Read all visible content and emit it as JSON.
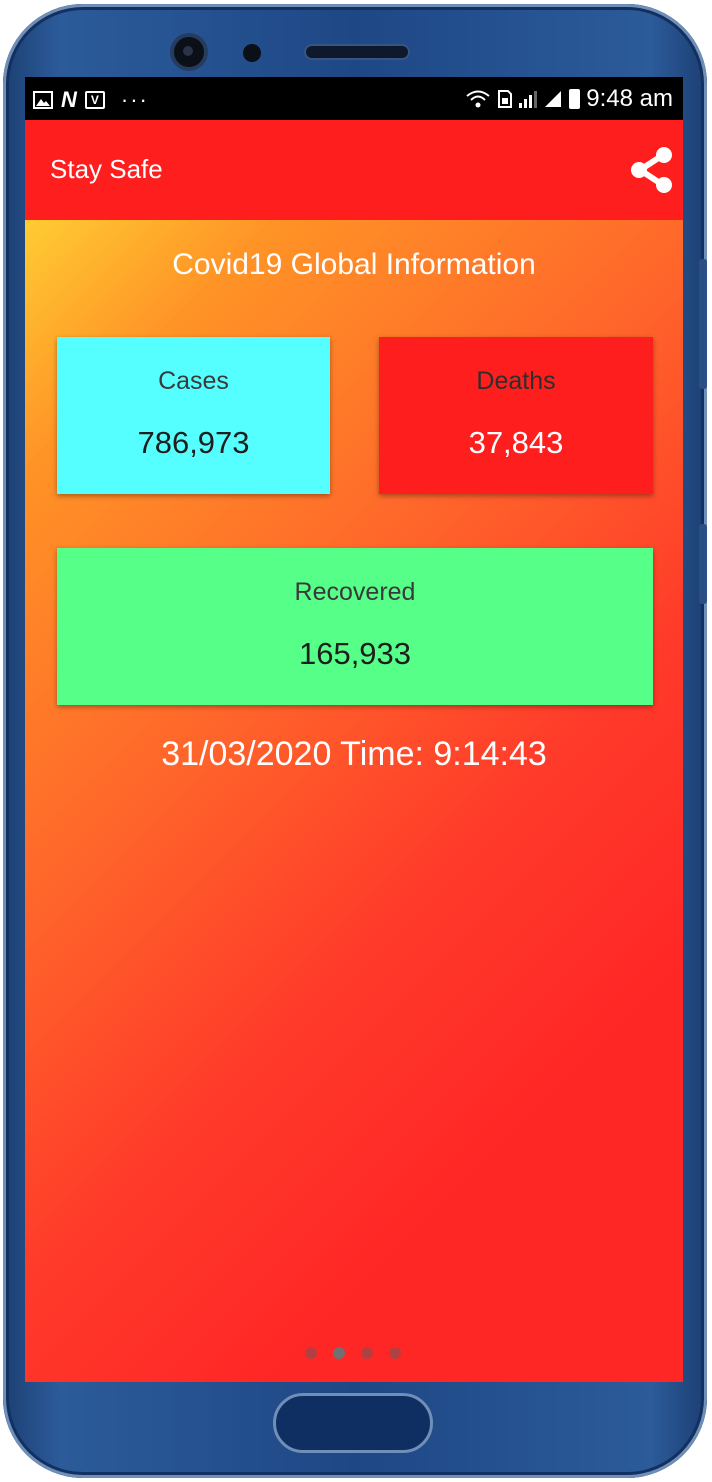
{
  "status_bar": {
    "time": "9:48 am",
    "left_icons": [
      "image-icon",
      "n-icon",
      "v-icon",
      "more-dots-icon"
    ],
    "right_icons": [
      "wifi-icon",
      "sim-icon",
      "signal-icon",
      "signal-icon-2",
      "battery-icon"
    ],
    "n_glyph": "N",
    "v_glyph": "V",
    "dots": "···"
  },
  "app_bar": {
    "title": "Stay Safe",
    "share_icon": "share-icon",
    "color": "#ff1e1e"
  },
  "main": {
    "heading": "Covid19 Global Information",
    "cards": {
      "cases": {
        "label": "Cases",
        "value": "786,973",
        "color": "#55ffff"
      },
      "deaths": {
        "label": "Deaths",
        "value": "37,843",
        "color": "#ff1e1e"
      },
      "recovered": {
        "label": "Recovered",
        "value": "165,933",
        "color": "#55ff88"
      }
    },
    "timestamp": "31/03/2020 Time: 9:14:43"
  },
  "pager": {
    "count": 4,
    "active_index": 1
  }
}
